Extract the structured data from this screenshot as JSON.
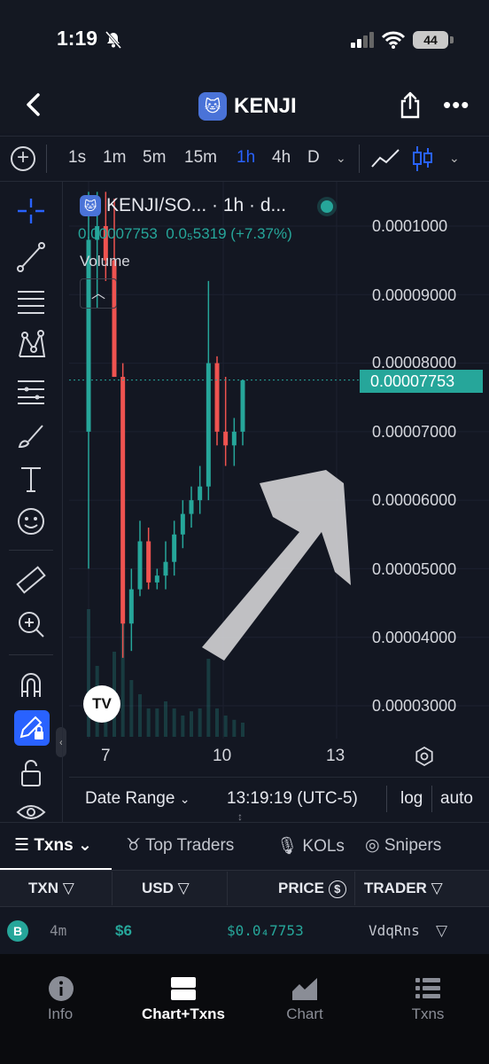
{
  "status_bar": {
    "time": "1:19",
    "battery": "44"
  },
  "header": {
    "coin_name": "KENJI",
    "coin_emoji": "🐱"
  },
  "timeframes": {
    "items": [
      "1s",
      "1m",
      "5m",
      "15m",
      "1h",
      "4h",
      "D"
    ],
    "selected": "1h"
  },
  "chart_legend": {
    "pair_title": "KENJI/SO... · 1h · d...",
    "price": "0.00007753",
    "change": "0.0₅5319 (+7.37%)",
    "volume_label": "Volume"
  },
  "chart_data": {
    "type": "candlestick",
    "title": "KENJI/SO... · 1h · d...",
    "y_ticks": [
      "0.0001000",
      "0.00009000",
      "0.00008000",
      "0.00007000",
      "0.00006000",
      "0.00005000",
      "0.00004000",
      "0.00003000"
    ],
    "x_ticks": [
      "7",
      "10",
      "13"
    ],
    "last_price": "0.00007753",
    "ylim": [
      2.8e-05,
      0.000105
    ],
    "series": [
      {
        "o": 7e-05,
        "h": 0.000105,
        "l": 5e-05,
        "c": 9.8e-05
      },
      {
        "o": 9.8e-05,
        "h": 0.000105,
        "l": 8.8e-05,
        "c": 0.0001
      },
      {
        "o": 0.0001,
        "h": 0.000105,
        "l": 9.2e-05,
        "c": 9.5e-05
      },
      {
        "o": 9.5e-05,
        "h": 0.000104,
        "l": 7.8e-05,
        "c": 7.8e-05
      },
      {
        "o": 7.8e-05,
        "h": 8e-05,
        "l": 3.7e-05,
        "c": 4.2e-05
      },
      {
        "o": 4.2e-05,
        "h": 5e-05,
        "l": 3.8e-05,
        "c": 4.7e-05
      },
      {
        "o": 4.7e-05,
        "h": 5.7e-05,
        "l": 4.6e-05,
        "c": 5.4e-05
      },
      {
        "o": 5.4e-05,
        "h": 5.6e-05,
        "l": 4.7e-05,
        "c": 4.8e-05
      },
      {
        "o": 4.8e-05,
        "h": 5e-05,
        "l": 4.7e-05,
        "c": 4.9e-05
      },
      {
        "o": 4.9e-05,
        "h": 5.4e-05,
        "l": 4.7e-05,
        "c": 5.1e-05
      },
      {
        "o": 5.1e-05,
        "h": 5.7e-05,
        "l": 4.9e-05,
        "c": 5.5e-05
      },
      {
        "o": 5.5e-05,
        "h": 6e-05,
        "l": 5.3e-05,
        "c": 5.8e-05
      },
      {
        "o": 5.8e-05,
        "h": 6.2e-05,
        "l": 5.6e-05,
        "c": 6e-05
      },
      {
        "o": 6e-05,
        "h": 6.5e-05,
        "l": 5.8e-05,
        "c": 6.2e-05
      },
      {
        "o": 6.2e-05,
        "h": 9.2e-05,
        "l": 6e-05,
        "c": 8e-05
      },
      {
        "o": 8e-05,
        "h": 8.1e-05,
        "l": 6.8e-05,
        "c": 7e-05
      },
      {
        "o": 7e-05,
        "h": 7.8e-05,
        "l": 6.5e-05,
        "c": 6.8e-05
      },
      {
        "o": 6.8e-05,
        "h": 7.2e-05,
        "l": 6.5e-05,
        "c": 7e-05
      },
      {
        "o": 7e-05,
        "h": 7.6e-05,
        "l": 6.8e-05,
        "c": 7.75e-05
      }
    ]
  },
  "chart_footer": {
    "date_range": "Date Range",
    "clock": "13:19:19 (UTC-5)",
    "log": "log",
    "auto": "auto"
  },
  "tabs": {
    "items": [
      "Txns",
      "Top Traders",
      "KOLs",
      "Snipers"
    ],
    "selected": "Txns"
  },
  "table": {
    "columns": [
      "TXN",
      "USD",
      "PRICE",
      "TRADER"
    ],
    "rows": [
      {
        "type": "B",
        "age": "4m",
        "usd": "$6",
        "price": "$0.0₄7753",
        "trader": "VdqRns"
      }
    ]
  },
  "bottom_nav": {
    "items": [
      "Info",
      "Chart+Txns",
      "Chart",
      "Txns"
    ],
    "selected": "Chart+Txns"
  },
  "colors": {
    "up": "#26a69a",
    "down": "#ef5350",
    "accent": "#2962ff",
    "background": "#131722"
  }
}
